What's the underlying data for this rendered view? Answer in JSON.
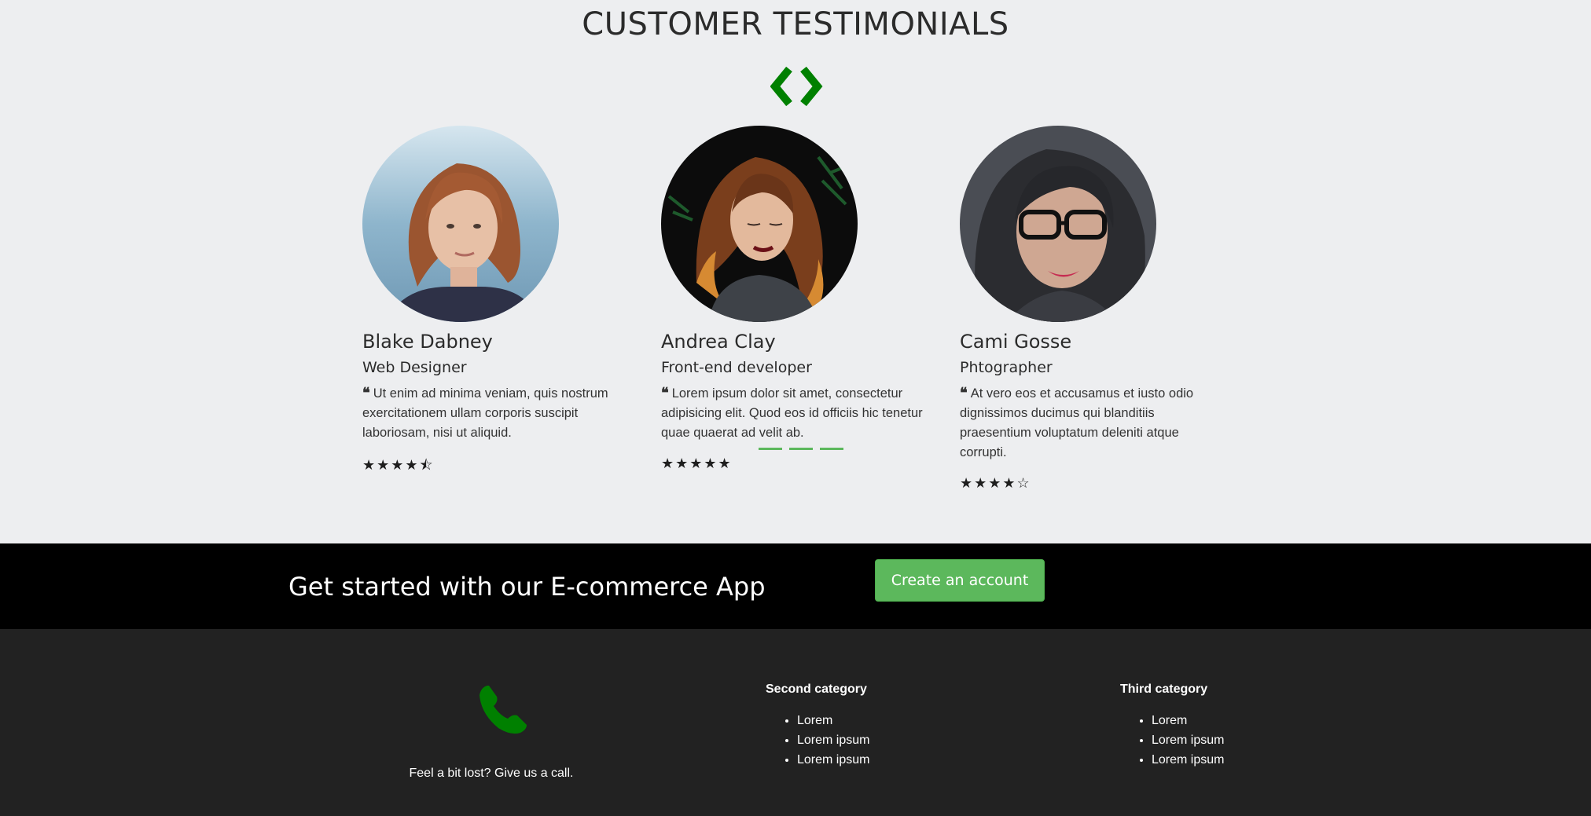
{
  "testimonials": {
    "title": "CUSTOMER TESTIMONIALS",
    "cards": [
      {
        "name": "Blake Dabney",
        "role": "Web Designer",
        "quote": "Ut enim ad minima veniam, quis nostrum exercitationem ullam corporis suscipit laboriosam, nisi ut aliquid.",
        "rating": 4.5,
        "stars": "★★★★⯪"
      },
      {
        "name": "Andrea Clay",
        "role": "Front-end developer",
        "quote": "Lorem ipsum dolor sit amet, consectetur adipisicing elit. Quod eos id officiis hic tenetur quae quaerat ad velit ab.",
        "rating": 5,
        "stars": "★★★★★"
      },
      {
        "name": "Cami Gosse",
        "role": "Phtographer",
        "quote": "At vero eos et accusamus et iusto odio dignissimos ducimus qui blanditiis praesentium voluptatum deleniti atque corrupti.",
        "rating": 4,
        "stars": "★★★★☆"
      }
    ]
  },
  "cta": {
    "text": "Get started with our E-commerce App",
    "button_label": "Create an account"
  },
  "footer": {
    "call_text": "Feel a bit lost? Give us a call.",
    "categories": [
      {
        "title": "Second category",
        "items": [
          "Lorem",
          "Lorem ipsum",
          "Lorem ipsum"
        ]
      },
      {
        "title": "Third category",
        "items": [
          "Lorem",
          "Lorem ipsum",
          "Lorem ipsum"
        ]
      }
    ]
  },
  "colors": {
    "accent_green": "#008000",
    "button_green": "#5cb85c",
    "cta_bg": "#000000",
    "footer_bg": "#222222"
  }
}
